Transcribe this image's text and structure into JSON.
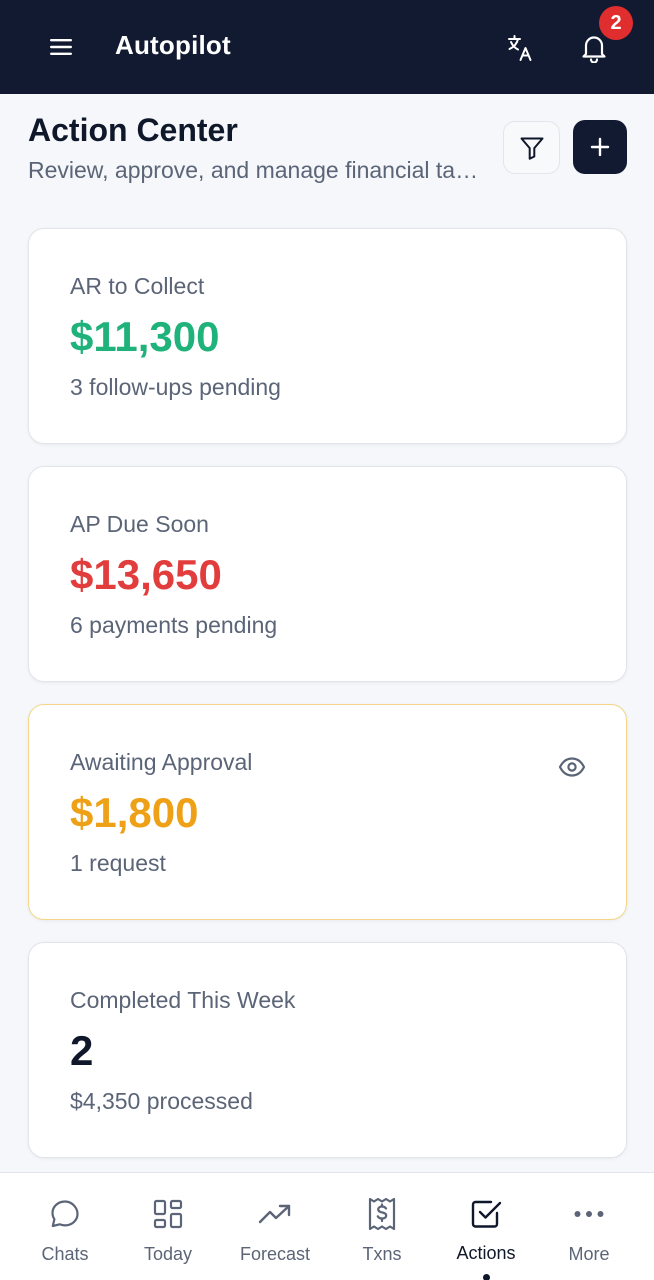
{
  "header": {
    "title": "Autopilot",
    "notification_count": "2"
  },
  "page": {
    "title": "Action Center",
    "subtitle": "Review, approve, and manage financial tasks"
  },
  "cards": [
    {
      "label": "AR to Collect",
      "value": "$11,300",
      "sub": "3 follow-ups pending",
      "color": "#1fb27a"
    },
    {
      "label": "AP Due Soon",
      "value": "$13,650",
      "sub": "6 payments pending",
      "color": "#e23d3d"
    },
    {
      "label": "Awaiting Approval",
      "value": "$1,800",
      "sub": "1 request",
      "color": "#eea017"
    },
    {
      "label": "Completed This Week",
      "value": "2",
      "sub": "$4,350 processed",
      "color": "#0f172a"
    }
  ],
  "nav": {
    "items": [
      {
        "label": "Chats",
        "icon": "chat-bubble-icon"
      },
      {
        "label": "Today",
        "icon": "dashboard-grid-icon"
      },
      {
        "label": "Forecast",
        "icon": "trending-up-icon"
      },
      {
        "label": "Txns",
        "icon": "receipt-dollar-icon"
      },
      {
        "label": "Actions",
        "icon": "checkbox-icon"
      },
      {
        "label": "More",
        "icon": "more-dots-icon"
      }
    ],
    "active": "Actions"
  },
  "colors": {
    "header_bg": "#111a31",
    "badge": "#e02d2d",
    "highlight_border": "#f6d58a"
  }
}
